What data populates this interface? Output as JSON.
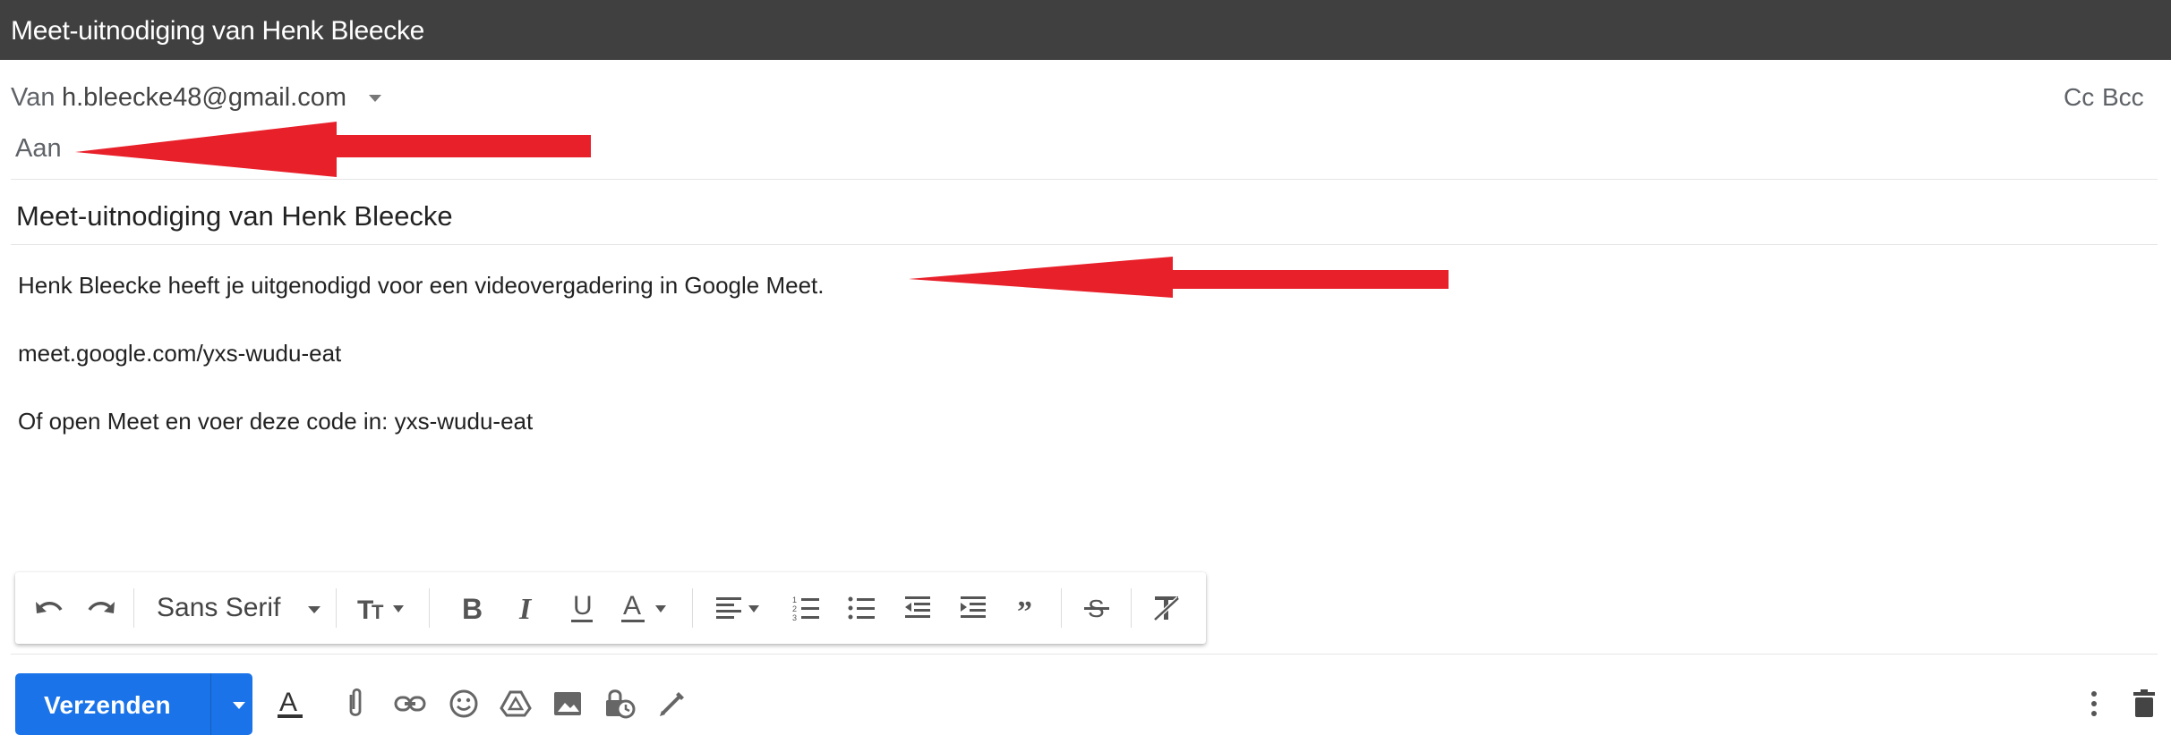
{
  "window": {
    "title": "Meet-uitnodiging van Henk Bleecke"
  },
  "header": {
    "from_label": "Van",
    "from_address": "h.bleecke48@gmail.com",
    "to_label": "Aan",
    "cc_label": "Cc",
    "bcc_label": "Bcc"
  },
  "subject": "Meet-uitnodiging van Henk Bleecke",
  "body": {
    "line1": "Henk Bleecke heeft je uitgenodigd voor een videovergadering in Google Meet.",
    "line2": "meet.google.com/yxs-wudu-eat",
    "line3": "Of open Meet en voer deze code in: yxs-wudu-eat"
  },
  "format_toolbar": {
    "font_name": "Sans Serif",
    "icons": [
      "undo-icon",
      "redo-icon",
      "font-size-icon",
      "bold-icon",
      "italic-icon",
      "underline-icon",
      "text-color-icon",
      "align-icon",
      "numbered-list-icon",
      "bulleted-list-icon",
      "indent-less-icon",
      "indent-more-icon",
      "quote-icon",
      "strikethrough-icon",
      "remove-formatting-icon"
    ]
  },
  "bottom_toolbar": {
    "send_label": "Verzenden",
    "icons": [
      "formatting-options-icon",
      "attach-icon",
      "link-icon",
      "emoji-icon",
      "drive-icon",
      "photo-icon",
      "confidential-mode-icon",
      "signature-icon",
      "more-options-icon",
      "discard-icon"
    ]
  },
  "annotations": {
    "arrow_color": "#e8202a"
  },
  "colors": {
    "titlebar": "#404040",
    "send_button": "#1a73e8"
  }
}
